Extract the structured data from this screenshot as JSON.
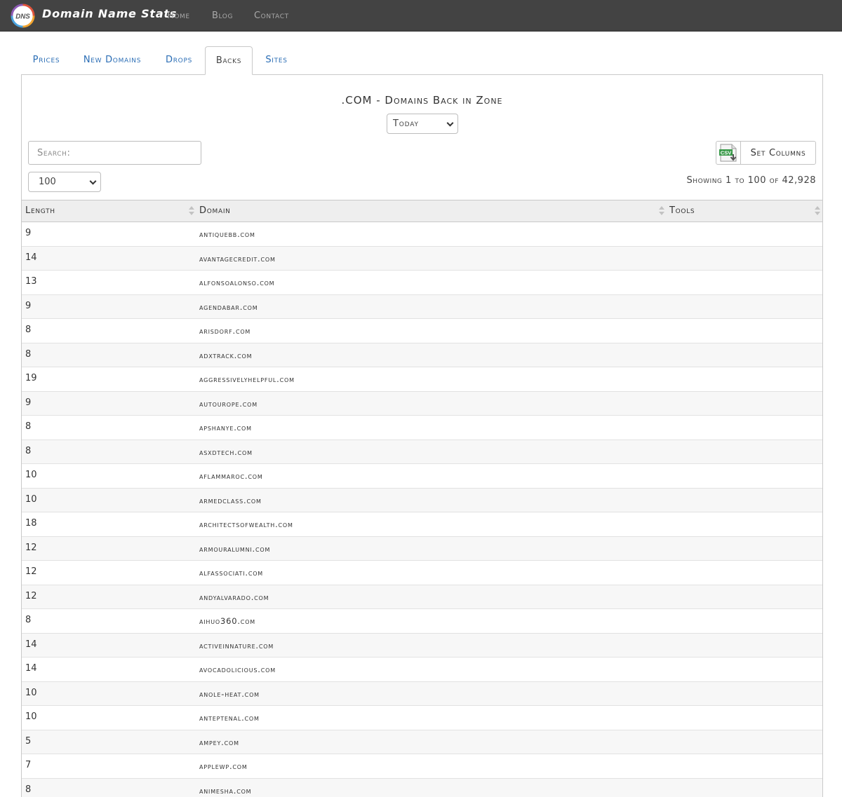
{
  "brand": {
    "logo_text": "DNS",
    "name": "Domain Name Stats"
  },
  "nav": [
    {
      "label": "Home"
    },
    {
      "label": "Blog"
    },
    {
      "label": "Contact"
    }
  ],
  "tabs": [
    {
      "label": "Prices"
    },
    {
      "label": "New Domains"
    },
    {
      "label": "Drops"
    },
    {
      "label": "Backs"
    },
    {
      "label": "Sites"
    }
  ],
  "active_tab": "Backs",
  "page_title": ".COM - Domains Back in Zone",
  "period_select": {
    "value": "Today"
  },
  "search": {
    "placeholder": "Search:"
  },
  "page_size_select": {
    "value": "100"
  },
  "csv_icon_label": "CSV",
  "set_columns_label": "Set Columns",
  "showing_text": "Showing 1 to 100 of 42,928",
  "table": {
    "columns": [
      "Length",
      "Domain",
      "Tools"
    ],
    "rows": [
      {
        "length": "9",
        "domain": "ANTIQUEBB.COM"
      },
      {
        "length": "14",
        "domain": "AVANTAGECREDIT.COM"
      },
      {
        "length": "13",
        "domain": "ALFONSOALONSO.COM"
      },
      {
        "length": "9",
        "domain": "AGENDABAR.COM"
      },
      {
        "length": "8",
        "domain": "ARISDORF.COM"
      },
      {
        "length": "8",
        "domain": "ADXTRACK.COM"
      },
      {
        "length": "19",
        "domain": "AGGRESSIVELYHELPFUL.COM"
      },
      {
        "length": "9",
        "domain": "AUTOUROPE.COM"
      },
      {
        "length": "8",
        "domain": "APSHANYE.COM"
      },
      {
        "length": "8",
        "domain": "ASXDTECH.COM"
      },
      {
        "length": "10",
        "domain": "AFLAMMAROC.COM"
      },
      {
        "length": "10",
        "domain": "ARMEDCLASS.COM"
      },
      {
        "length": "18",
        "domain": "ARCHITECTSOFWEALTH.COM"
      },
      {
        "length": "12",
        "domain": "ARMOURALUMNI.COM"
      },
      {
        "length": "12",
        "domain": "ALFASSOCIATI.COM"
      },
      {
        "length": "12",
        "domain": "ANDYALVARADO.COM"
      },
      {
        "length": "8",
        "domain": "AIHUO360.COM"
      },
      {
        "length": "14",
        "domain": "ACTIVEINNATURE.COM"
      },
      {
        "length": "14",
        "domain": "AVOCADOLICIOUS.COM"
      },
      {
        "length": "10",
        "domain": "ANOLE-HEAT.COM"
      },
      {
        "length": "10",
        "domain": "ANTEPTENAL.COM"
      },
      {
        "length": "5",
        "domain": "AMPEY.COM"
      },
      {
        "length": "7",
        "domain": "APPLEWP.COM"
      },
      {
        "length": "8",
        "domain": "ANIMESHA.COM"
      }
    ]
  },
  "colors": {
    "navbar_bg": "#434343",
    "link_blue": "#2a6db5",
    "table_header_bg": "#eeeeee",
    "csv_green": "#3a9a4a"
  }
}
